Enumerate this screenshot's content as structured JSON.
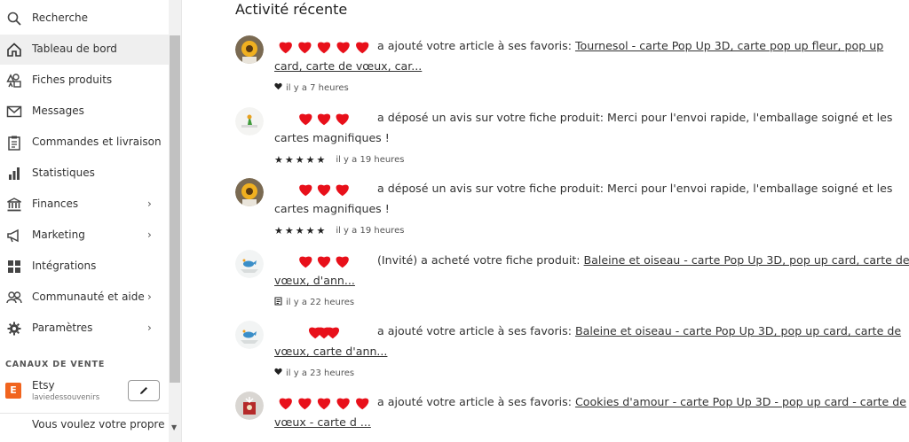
{
  "sidebar": {
    "items": [
      {
        "label": "Recherche",
        "icon": "search-icon",
        "chevron": false,
        "active": false
      },
      {
        "label": "Tableau de bord",
        "icon": "home-icon",
        "chevron": false,
        "active": true
      },
      {
        "label": "Fiches produits",
        "icon": "listings-icon",
        "chevron": false,
        "active": false
      },
      {
        "label": "Messages",
        "icon": "mail-icon",
        "chevron": false,
        "active": false
      },
      {
        "label": "Commandes et livraison",
        "icon": "clipboard-icon",
        "chevron": false,
        "active": false
      },
      {
        "label": "Statistiques",
        "icon": "bar-chart-icon",
        "chevron": false,
        "active": false
      },
      {
        "label": "Finances",
        "icon": "bank-icon",
        "chevron": true,
        "active": false
      },
      {
        "label": "Marketing",
        "icon": "megaphone-icon",
        "chevron": true,
        "active": false
      },
      {
        "label": "Intégrations",
        "icon": "grid-icon",
        "chevron": false,
        "active": false
      },
      {
        "label": "Communauté et aide",
        "icon": "people-icon",
        "chevron": true,
        "active": false
      },
      {
        "label": "Paramètres",
        "icon": "gear-icon",
        "chevron": true,
        "active": false
      }
    ],
    "chevron_glyph": "›",
    "sales_channels_heading": "CANAUX DE VENTE",
    "channel": {
      "badge": "E",
      "name": "Etsy",
      "shop": "laviedessouvenirs"
    },
    "bottom_text": "Vous voulez votre propre"
  },
  "main": {
    "title": "Activité récente",
    "activities": [
      {
        "action": " a ajouté votre article à ses favoris: ",
        "link": "Tournesol - carte Pop Up 3D, carte pop up fleur, pop up card, carte de vœux, car...",
        "meta_icon": "heart-icon",
        "stars": "",
        "time": "il y a 7 heures",
        "avatar": "sunflower"
      },
      {
        "action": " a déposé un avis sur votre fiche produit: Merci pour l'envoi rapide, l'emballage soigné et les cartes magnifiques !",
        "link": "",
        "meta_icon": "",
        "stars": "★★★★★",
        "time": "il y a 19 heures",
        "avatar": "bird"
      },
      {
        "action": " a déposé un avis sur votre fiche produit: Merci pour l'envoi rapide, l'emballage soigné et les cartes magnifiques !",
        "link": "",
        "meta_icon": "",
        "stars": "★★★★★",
        "time": "il y a 19 heures",
        "avatar": "sunflower"
      },
      {
        "action": " (Invité) a acheté votre fiche produit: ",
        "link": "Baleine et oiseau - carte Pop Up 3D, pop up card, carte de vœux, d'ann...",
        "meta_icon": "receipt-icon",
        "stars": "",
        "time": "il y a 22 heures",
        "avatar": "whale"
      },
      {
        "action": " a ajouté votre article à ses favoris: ",
        "link": "Baleine et oiseau - carte Pop Up 3D, pop up card, carte de vœux, carte d'ann...",
        "meta_icon": "heart-icon",
        "stars": "",
        "time": "il y a 23 heures",
        "avatar": "whale"
      },
      {
        "action": " a ajouté votre article à ses favoris: ",
        "link": "Cookies d'amour - carte Pop Up 3D - pop up card - carte de vœux - carte d ...",
        "meta_icon": "",
        "stars": "",
        "time": "",
        "avatar": "cookies"
      }
    ]
  },
  "colors": {
    "active_bg": "#efefef",
    "redaction": "#e8101a",
    "etsy_orange": "#f1641e"
  }
}
